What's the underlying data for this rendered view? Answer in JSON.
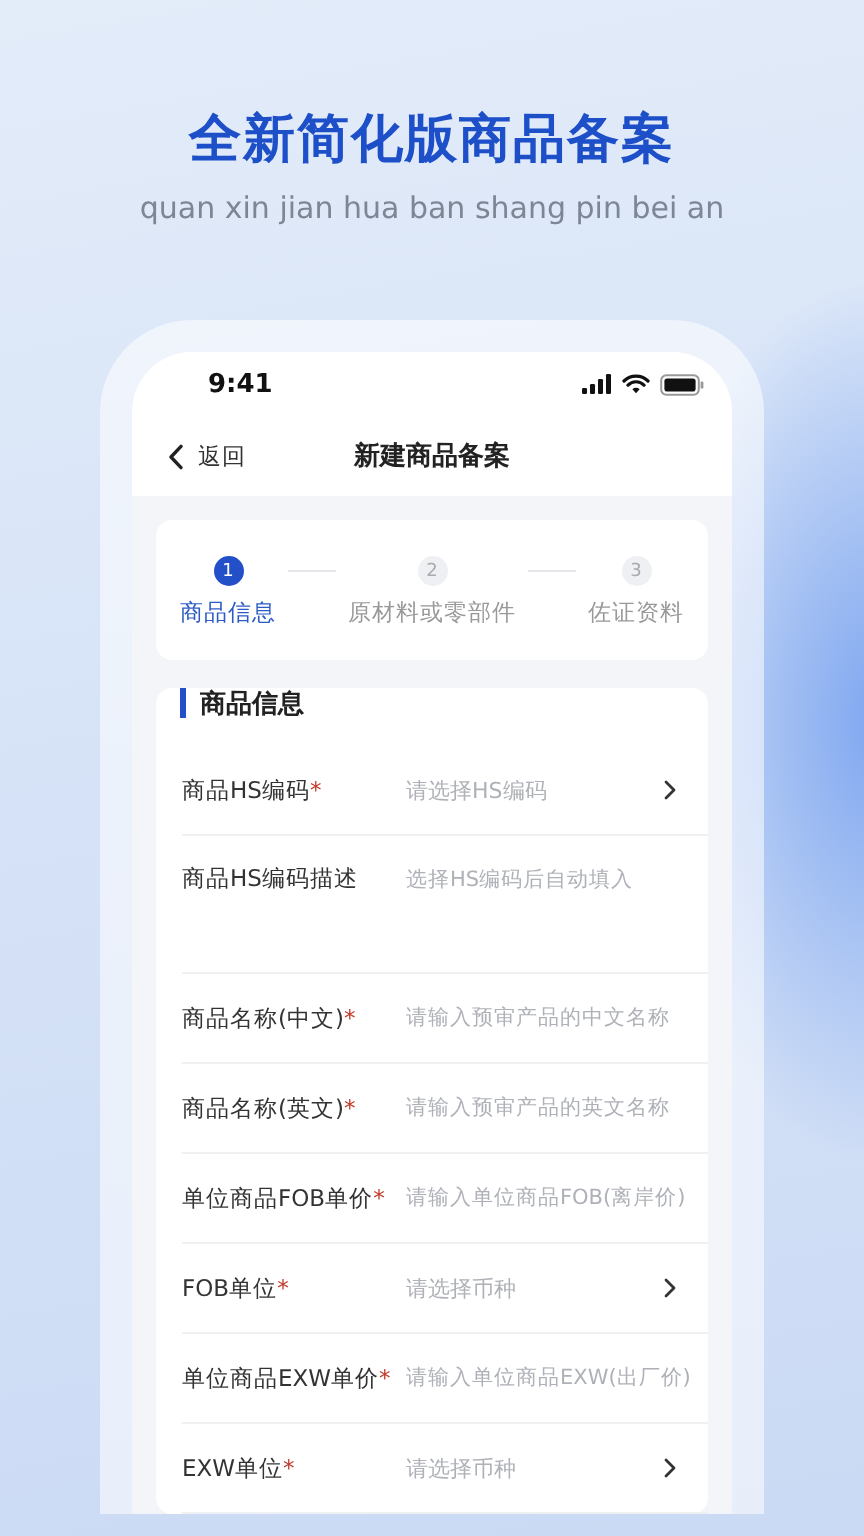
{
  "headline": "全新简化版商品备案",
  "subheadline": "quan xin jian hua ban shang pin bei an",
  "status_bar": {
    "time": "9:41"
  },
  "nav": {
    "back": "返回",
    "title": "新建商品备案"
  },
  "steps": [
    {
      "number": "1",
      "label": "商品信息",
      "selected": true
    },
    {
      "number": "2",
      "label": "原材料或零部件",
      "selected": false
    },
    {
      "number": "3",
      "label": "佐证资料",
      "selected": false
    }
  ],
  "form": {
    "section_title": "商品信息",
    "required_marker": "*",
    "fields": [
      {
        "label": "商品HS编码",
        "required": true,
        "kind": "select",
        "placeholder": "请选择HS编码"
      },
      {
        "label": "商品HS编码描述",
        "required": false,
        "kind": "auto",
        "placeholder": "选择HS编码后自动填入"
      },
      {
        "label": "商品名称(中文)",
        "required": true,
        "kind": "input",
        "placeholder": "请输入预审产品的中文名称"
      },
      {
        "label": "商品名称(英文)",
        "required": true,
        "kind": "input",
        "placeholder": "请输入预审产品的英文名称"
      },
      {
        "label": "单位商品FOB单价",
        "required": true,
        "kind": "input",
        "placeholder": "请输入单位商品FOB(离岸价)"
      },
      {
        "label": "FOB单位",
        "required": true,
        "kind": "select",
        "placeholder": "请选择币种"
      },
      {
        "label": "单位商品EXW单价",
        "required": true,
        "kind": "input",
        "placeholder": "请输入单位商品EXW(出厂价)"
      },
      {
        "label": "EXW单位",
        "required": true,
        "kind": "select",
        "placeholder": "请选择币种"
      }
    ]
  }
}
